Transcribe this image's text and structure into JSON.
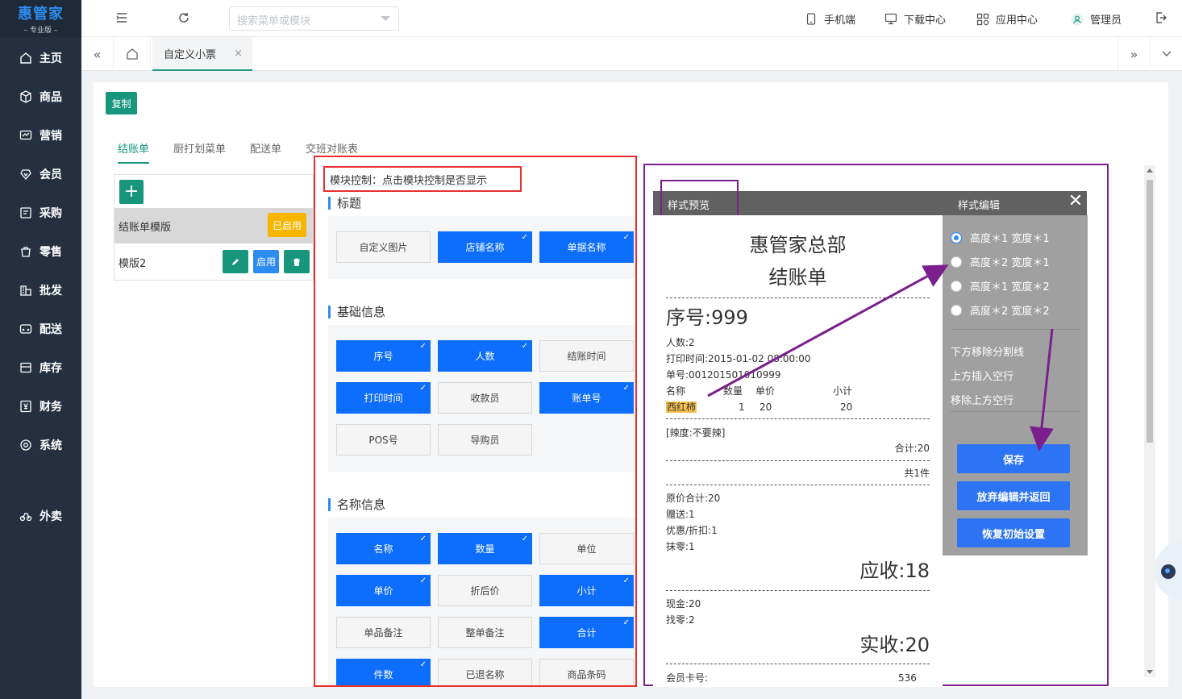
{
  "brand": {
    "name": "惠管家",
    "edition": "– 专业版 –"
  },
  "sidebar": {
    "items": [
      {
        "label": "主页",
        "icon": "home-icon"
      },
      {
        "label": "商品",
        "icon": "box-icon"
      },
      {
        "label": "营销",
        "icon": "chart-icon"
      },
      {
        "label": "会员",
        "icon": "member-icon"
      },
      {
        "label": "采购",
        "icon": "purchase-icon"
      },
      {
        "label": "零售",
        "icon": "bag-icon"
      },
      {
        "label": "批发",
        "icon": "building-icon"
      },
      {
        "label": "配送",
        "icon": "delivery-icon"
      },
      {
        "label": "库存",
        "icon": "inventory-icon"
      },
      {
        "label": "财务",
        "icon": "yen-icon"
      },
      {
        "label": "系统",
        "icon": "settings-icon"
      },
      {
        "label": "外卖",
        "icon": "bike-icon"
      }
    ]
  },
  "topbar": {
    "search_placeholder": "搜索菜单或模块",
    "mobile": "手机端",
    "download": "下载中心",
    "apps": "应用中心",
    "user": "管理员"
  },
  "tabs": {
    "active": "自定义小票",
    "close": "×"
  },
  "page": {
    "copy_button": "复制",
    "subtabs": [
      "结账单",
      "厨打划菜单",
      "配送单",
      "交班对账表"
    ],
    "templates": [
      {
        "name": "结账单模版",
        "status": "已启用"
      },
      {
        "name": "模版2",
        "enable": "启用"
      }
    ]
  },
  "modules": {
    "hint": "模块控制：点击模块控制是否显示",
    "sections": [
      {
        "title": "标题",
        "chips": [
          {
            "label": "自定义图片",
            "on": false
          },
          {
            "label": "店铺名称",
            "on": true
          },
          {
            "label": "单据名称",
            "on": true
          }
        ]
      },
      {
        "title": "基础信息",
        "chips": [
          {
            "label": "序号",
            "on": true
          },
          {
            "label": "人数",
            "on": true
          },
          {
            "label": "结账时间",
            "on": false
          },
          {
            "label": "打印时间",
            "on": true
          },
          {
            "label": "收款员",
            "on": false
          },
          {
            "label": "账单号",
            "on": true
          },
          {
            "label": "POS号",
            "on": false
          },
          {
            "label": "导购员",
            "on": false
          }
        ]
      },
      {
        "title": "名称信息",
        "chips": [
          {
            "label": "名称",
            "on": true
          },
          {
            "label": "数量",
            "on": true
          },
          {
            "label": "单位",
            "on": false
          },
          {
            "label": "单价",
            "on": true
          },
          {
            "label": "折后价",
            "on": false
          },
          {
            "label": "小计",
            "on": true
          },
          {
            "label": "单品备注",
            "on": false
          },
          {
            "label": "整单备注",
            "on": false
          },
          {
            "label": "合计",
            "on": true
          },
          {
            "label": "件数",
            "on": true
          },
          {
            "label": "已退名称",
            "on": false
          },
          {
            "label": "商品条码",
            "on": false
          }
        ]
      }
    ]
  },
  "preview": {
    "title": "样式预览",
    "edit_title": "样式编辑",
    "close": "✕",
    "receipt": {
      "store": "惠管家总部",
      "doc": "结账单",
      "serial": "序号:999",
      "people": "人数:2",
      "print_time": "打印时间:2015-01-02 08:00:00",
      "bill_no": "单号:0012015010​10999",
      "col_name": "名称",
      "col_qty": "数量",
      "col_price": "单价",
      "col_sub": "小计",
      "item_name": "西红柿",
      "item_qty": "1",
      "item_price": "20",
      "item_sub": "20",
      "note": "[辣度:不要辣]",
      "total": "合计:20",
      "count": "共1件",
      "orig_total": "原价合计:20",
      "gift": "赠送:1",
      "discount": "优惠/折扣:1",
      "round": "抹零:1",
      "receivable": "应收:18",
      "cash": "现金:20",
      "change": "找零:2",
      "paid": "实收:20",
      "member_label": "会员卡号:",
      "member_no": "536"
    },
    "options": [
      "高度＊1 宽度＊1",
      "高度＊2 宽度＊1",
      "高度＊1 宽度＊2",
      "高度＊2 宽度＊2"
    ],
    "actions": [
      "下方移除分割线",
      "上方插入空行",
      "移除上方空行"
    ],
    "buttons": {
      "save": "保存",
      "discard": "放弃编辑并返回",
      "reset": "恢复初始设置"
    }
  },
  "colors": {
    "accent": "#17967b",
    "primary": "#0d6efd",
    "warning": "#f7b500",
    "annotation_red": "#e8302f",
    "annotation_purple": "#7b1f8e"
  }
}
